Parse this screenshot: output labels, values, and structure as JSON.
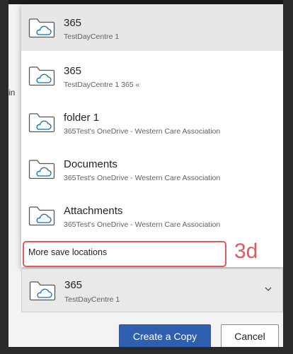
{
  "background": {
    "left_fragment": "in",
    "close_glyph": "×"
  },
  "locations": [
    {
      "title": "365",
      "subtitle": "TestDayCentre 1",
      "icon": "cloud-folder-icon",
      "selected": true
    },
    {
      "title": "365",
      "subtitle": "TestDayCentre 1 365 «",
      "icon": "cloud-folder-icon",
      "selected": false
    },
    {
      "title": "folder 1",
      "subtitle": "365Test's OneDrive - Western Care Association",
      "icon": "cloud-folder-icon",
      "selected": false
    },
    {
      "title": "Documents",
      "subtitle": "365Test's OneDrive - Western Care Association",
      "icon": "cloud-folder-icon",
      "selected": false
    },
    {
      "title": "Attachments",
      "subtitle": "365Test's OneDrive - Western Care Association",
      "icon": "cloud-folder-icon",
      "selected": false
    }
  ],
  "more_locations": {
    "label": "More save locations"
  },
  "annotation": {
    "label": "3d",
    "color": "#e3585a"
  },
  "location_select": {
    "title": "365",
    "subtitle": "TestDayCentre 1",
    "icon": "cloud-folder-icon",
    "chevron": "chevron-down-icon"
  },
  "buttons": {
    "create_copy": "Create a Copy",
    "cancel": "Cancel"
  },
  "colors": {
    "primary": "#2e5fb0",
    "selected_row": "#e7e7e7",
    "annotation": "#e3585a"
  }
}
